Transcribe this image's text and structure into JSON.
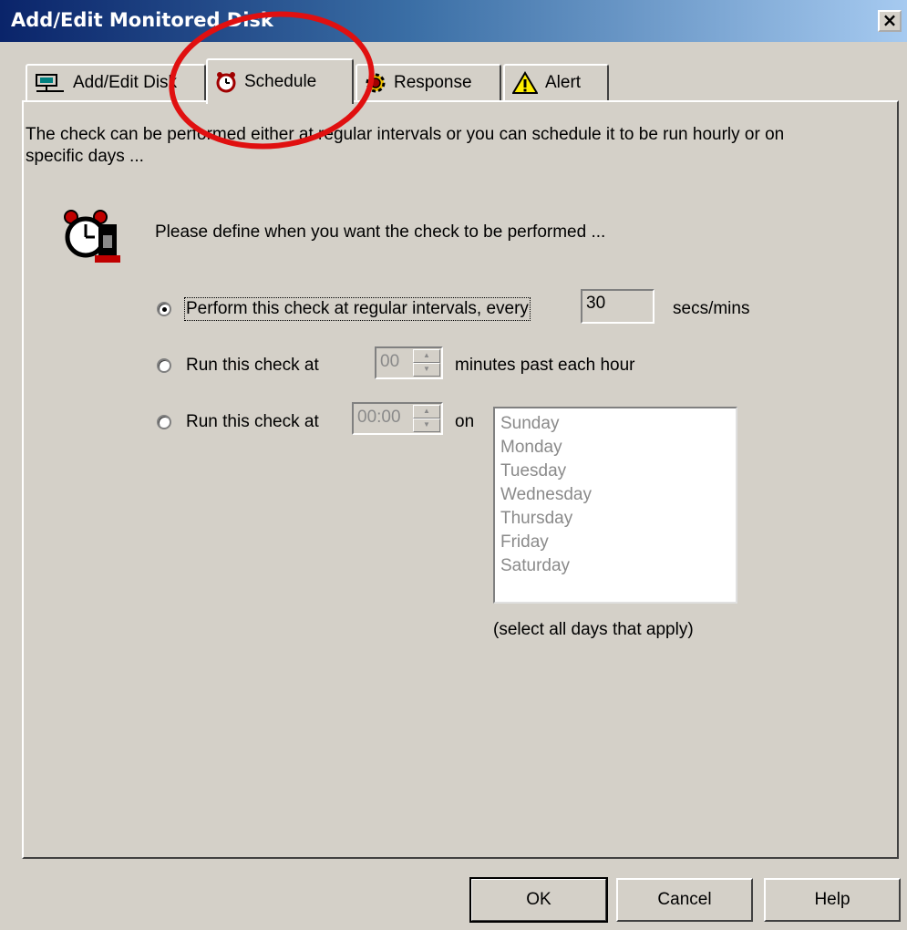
{
  "window": {
    "title": "Add/Edit Monitored Disk",
    "close_glyph": "×"
  },
  "tabs": [
    {
      "label": "Add/Edit Disk",
      "icon": "network-disk-icon",
      "active": false
    },
    {
      "label": "Schedule",
      "icon": "alarm-clock-icon",
      "active": true
    },
    {
      "label": "Response",
      "icon": "gear-icon",
      "active": false
    },
    {
      "label": "Alert",
      "icon": "warning-icon",
      "active": false
    }
  ],
  "schedule": {
    "intro": "The check can be performed either at regular intervals or you can schedule it to be run hourly or on specific days ...",
    "prompt": "Please define when you want the check to be performed ...",
    "option_interval": {
      "label": "Perform this check at regular intervals, every",
      "value": "30",
      "unit": "secs/mins",
      "checked": true
    },
    "option_hourly": {
      "label": "Run this check at",
      "value": "00",
      "suffix": "minutes past each hour",
      "checked": false
    },
    "option_daily": {
      "label": "Run this check at",
      "value": "00:00",
      "suffix": "on",
      "checked": false
    },
    "days": [
      "Sunday",
      "Monday",
      "Tuesday",
      "Wednesday",
      "Thursday",
      "Friday",
      "Saturday"
    ],
    "days_hint": "(select all days that apply)"
  },
  "buttons": {
    "ok": "OK",
    "cancel": "Cancel",
    "help": "Help"
  },
  "colors": {
    "annotation_circle": "#e01010",
    "titlebar_start": "#0a246a",
    "titlebar_end": "#a6caf0"
  }
}
